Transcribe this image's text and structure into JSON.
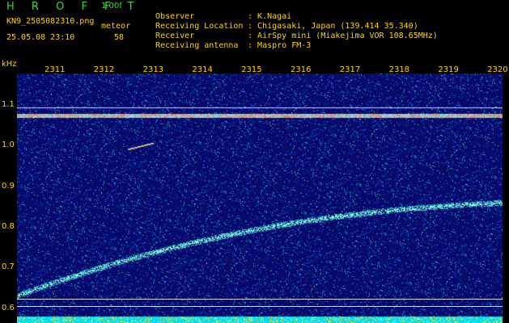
{
  "header": {
    "app_title": "H R O F F T",
    "version": "1.00f",
    "filename": "KN9_2505082310.png",
    "datetime": "25.05.08 23:10",
    "meteor_label": "meteor",
    "meteor_count": "58"
  },
  "info": [
    {
      "label": "Observer",
      "value": "K.Nagai"
    },
    {
      "label": "Receiving Location",
      "value": "Chigasaki, Japan (139.414 35.340)"
    },
    {
      "label": "Receiver",
      "value": "AirSpy mini (Miakejima VOR 108.65MHz)"
    },
    {
      "label": "Receiving antenna",
      "value": "Maspro FM-3"
    }
  ],
  "plot": {
    "y_unit": "kHz",
    "y_ticks": [
      "1.1",
      "1.0",
      "0.9",
      "0.8",
      "0.7",
      "0.6"
    ],
    "x_ticks": [
      "2311",
      "2312",
      "2313",
      "2314",
      "2315",
      "2316",
      "2317",
      "2318",
      "2319",
      "2320"
    ],
    "colors": {
      "background": "#0a0a6a",
      "signal": "#7fffd4",
      "axis": "#ffd400",
      "title": "#3dd63d"
    }
  }
}
